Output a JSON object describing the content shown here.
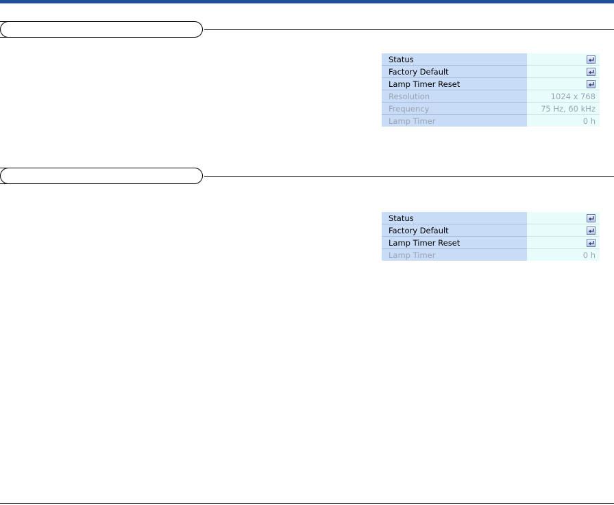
{
  "menu_a": {
    "rows": [
      {
        "label": "Status",
        "kind": "enter",
        "icon": "enter-icon"
      },
      {
        "label": "Factory Default",
        "kind": "enter",
        "icon": "enter-icon"
      },
      {
        "label": "Lamp Timer Reset",
        "kind": "enter",
        "icon": "enter-icon"
      },
      {
        "label": "Resolution",
        "kind": "value",
        "value": "1024 x 768"
      },
      {
        "label": "Frequency",
        "kind": "value",
        "value": "75 Hz, 60 kHz"
      },
      {
        "label": "Lamp Timer",
        "kind": "value",
        "value": "0 h"
      }
    ]
  },
  "menu_b": {
    "rows": [
      {
        "label": "Status",
        "kind": "enter",
        "icon": "enter-icon"
      },
      {
        "label": "Factory Default",
        "kind": "enter",
        "icon": "enter-icon"
      },
      {
        "label": "Lamp Timer Reset",
        "kind": "enter",
        "icon": "enter-icon"
      },
      {
        "label": "Lamp Timer",
        "kind": "value",
        "value": "0 h"
      }
    ]
  },
  "colors": {
    "header_bar": "#1f4e9c",
    "label_column": "#c9dcf7",
    "value_column": "#e8fcfc",
    "dim_text": "#9aa4b2"
  }
}
